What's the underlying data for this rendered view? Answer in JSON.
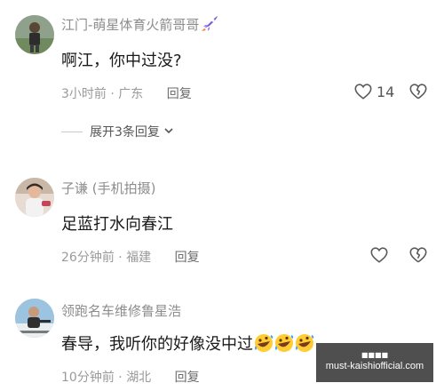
{
  "comments": [
    {
      "username": "江门-萌星体育火箭哥哥",
      "badge_icon": "rocket-icon",
      "text": "啊江，你中过没?",
      "time": "3小时前",
      "location": "广东",
      "reply_label": "回复",
      "like_count": "14",
      "expand_label": "展开3条回复"
    },
    {
      "username": "子谦 (手机拍摄)",
      "text": "足蓝打水向春江",
      "time": "26分钟前",
      "location": "福建",
      "reply_label": "回复"
    },
    {
      "username": "领跑名车维修鲁星浩",
      "text": "春导，我听你的好像没中过",
      "time": "10分钟前",
      "location": "湖北",
      "reply_label": "回复",
      "emoji": [
        "rofl-emoji",
        "rofl-emoji",
        "rofl-emoji"
      ]
    }
  ],
  "watermark": {
    "line1": "■■■■",
    "line2": "must-kaishiofficial.com"
  },
  "colors": {
    "meta": "#9a9a9a",
    "text": "#1a1a1a",
    "username": "#8d8d8d"
  }
}
